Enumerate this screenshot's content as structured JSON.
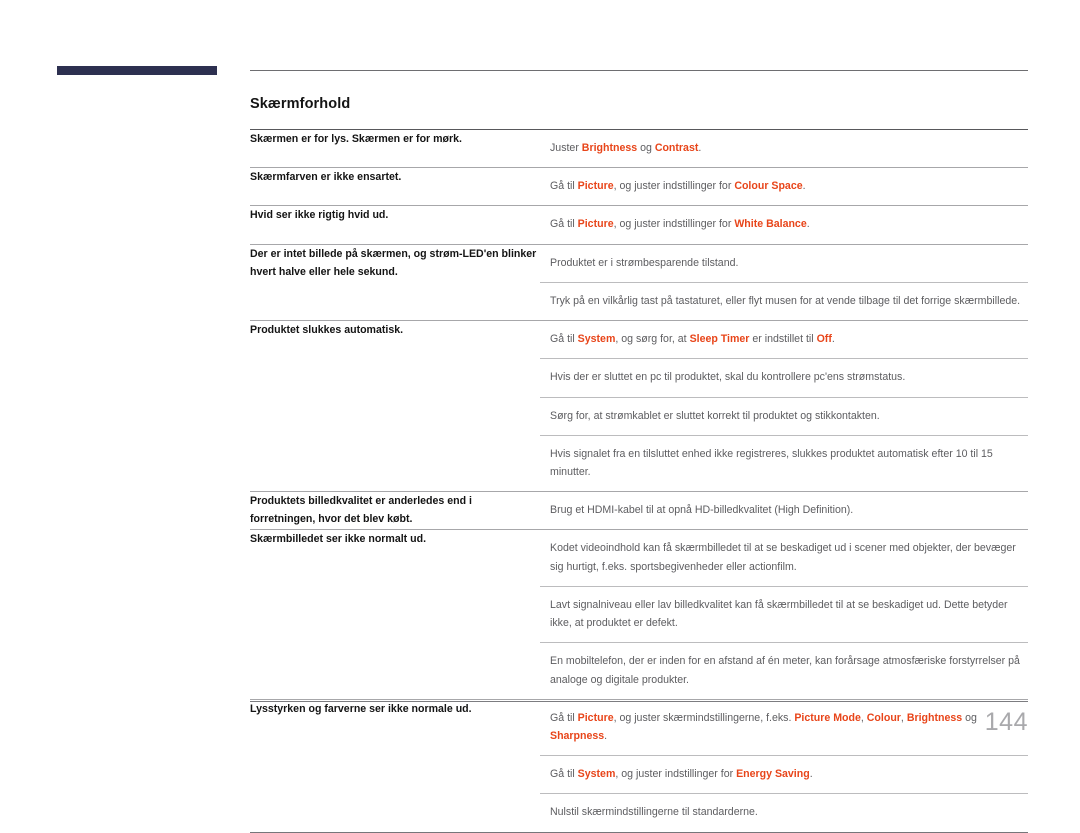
{
  "page": {
    "number": "144",
    "section_title": "Skærmforhold",
    "accent_color": "#e8451a",
    "header_bar_color": "#2d3050"
  },
  "table": {
    "rows": [
      {
        "symptom": "Skærmen er for lys. Skærmen er for mørk.",
        "solutions": [
          [
            {
              "t": "Juster ",
              "b": false
            },
            {
              "t": "Brightness",
              "b": true
            },
            {
              "t": " og ",
              "b": false
            },
            {
              "t": "Contrast",
              "b": true
            },
            {
              "t": ".",
              "b": false
            }
          ]
        ]
      },
      {
        "symptom": "Skærmfarven er ikke ensartet.",
        "solutions": [
          [
            {
              "t": "Gå til ",
              "b": false
            },
            {
              "t": "Picture",
              "b": true
            },
            {
              "t": ", og juster indstillinger for ",
              "b": false
            },
            {
              "t": "Colour Space",
              "b": true
            },
            {
              "t": ".",
              "b": false
            }
          ]
        ]
      },
      {
        "symptom": "Hvid ser ikke rigtig hvid ud.",
        "solutions": [
          [
            {
              "t": "Gå til ",
              "b": false
            },
            {
              "t": "Picture",
              "b": true
            },
            {
              "t": ", og juster indstillinger for ",
              "b": false
            },
            {
              "t": "White Balance",
              "b": true
            },
            {
              "t": ".",
              "b": false
            }
          ]
        ]
      },
      {
        "symptom": "Der er intet billede på skærmen, og strøm-LED'en blinker hvert halve eller hele sekund.",
        "solutions": [
          [
            {
              "t": "Produktet er i strømbesparende tilstand.",
              "b": false
            }
          ],
          [
            {
              "t": "Tryk på en vilkårlig tast på tastaturet, eller flyt musen for at vende tilbage til det forrige skærmbillede.",
              "b": false
            }
          ]
        ]
      },
      {
        "symptom": "Produktet slukkes automatisk.",
        "solutions": [
          [
            {
              "t": "Gå til ",
              "b": false
            },
            {
              "t": "System",
              "b": true
            },
            {
              "t": ", og sørg for, at ",
              "b": false
            },
            {
              "t": "Sleep Timer",
              "b": true
            },
            {
              "t": " er indstillet til ",
              "b": false
            },
            {
              "t": "Off",
              "b": true
            },
            {
              "t": ".",
              "b": false
            }
          ],
          [
            {
              "t": "Hvis der er sluttet en pc til produktet, skal du kontrollere pc'ens strømstatus.",
              "b": false
            }
          ],
          [
            {
              "t": "Sørg for, at strømkablet er sluttet korrekt til produktet og stikkontakten.",
              "b": false
            }
          ],
          [
            {
              "t": "Hvis signalet fra en tilsluttet enhed ikke registreres, slukkes produktet automatisk efter 10 til 15 minutter.",
              "b": false
            }
          ]
        ]
      },
      {
        "symptom": "Produktets billedkvalitet er anderledes end i forretningen, hvor det blev købt.",
        "solutions": [
          [
            {
              "t": "Brug et HDMI-kabel til at opnå HD-billedkvalitet (High Definition).",
              "b": false
            }
          ]
        ]
      },
      {
        "symptom": "Skærmbilledet ser ikke normalt ud.",
        "solutions": [
          [
            {
              "t": "Kodet videoindhold kan få skærmbilledet til at se beskadiget ud i scener med objekter, der bevæger sig hurtigt, f.eks. sportsbegivenheder eller actionfilm.",
              "b": false
            }
          ],
          [
            {
              "t": "Lavt signalniveau eller lav billedkvalitet kan få skærmbilledet til at se beskadiget ud. Dette betyder ikke, at produktet er defekt.",
              "b": false
            }
          ],
          [
            {
              "t": "En mobiltelefon, der er inden for en afstand af én meter, kan forårsage atmosfæriske forstyrrelser på analoge og digitale produkter.",
              "b": false
            }
          ]
        ]
      },
      {
        "symptom": "Lysstyrken og farverne ser ikke normale ud.",
        "solutions": [
          [
            {
              "t": "Gå til ",
              "b": false
            },
            {
              "t": "Picture",
              "b": true
            },
            {
              "t": ", og juster skærmindstillingerne, f.eks. ",
              "b": false
            },
            {
              "t": "Picture Mode",
              "b": true
            },
            {
              "t": ", ",
              "b": false
            },
            {
              "t": "Colour",
              "b": true
            },
            {
              "t": ", ",
              "b": false
            },
            {
              "t": "Brightness",
              "b": true
            },
            {
              "t": " og ",
              "b": false
            },
            {
              "t": "Sharpness",
              "b": true
            },
            {
              "t": ".",
              "b": false
            }
          ],
          [
            {
              "t": "Gå til ",
              "b": false
            },
            {
              "t": "System",
              "b": true
            },
            {
              "t": ", og juster indstillinger for ",
              "b": false
            },
            {
              "t": "Energy Saving",
              "b": true
            },
            {
              "t": ".",
              "b": false
            }
          ],
          [
            {
              "t": "Nulstil skærmindstillingerne til standarderne.",
              "b": false
            }
          ]
        ]
      }
    ]
  }
}
